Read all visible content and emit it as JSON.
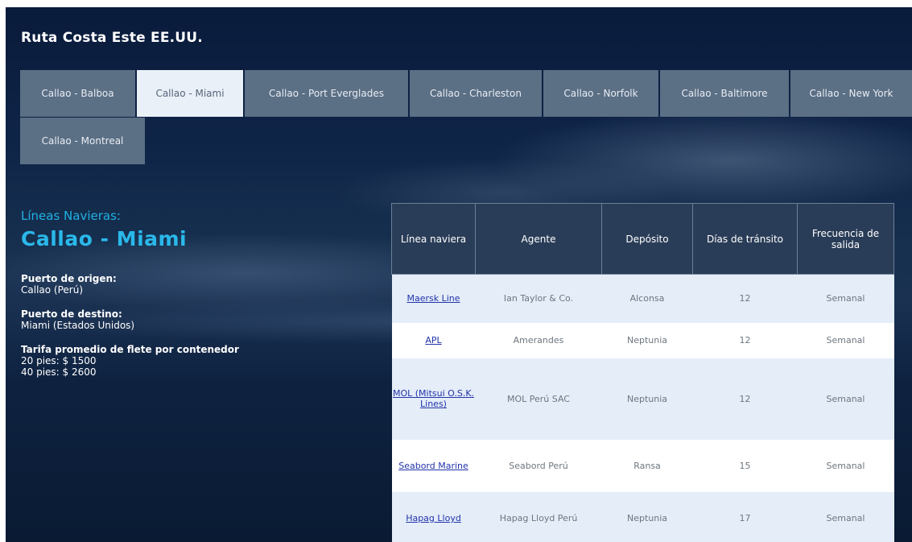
{
  "site": {
    "title": "Ruta Costa Este EE.UU."
  },
  "tabs": [
    {
      "label": "Callao - Balboa",
      "active": false
    },
    {
      "label": "Callao - Miami",
      "active": true
    },
    {
      "label": "Callao - Port Everglades",
      "active": false
    },
    {
      "label": "Callao - Charleston",
      "active": false
    },
    {
      "label": "Callao - Norfolk",
      "active": false
    },
    {
      "label": "Callao - Baltimore",
      "active": false
    },
    {
      "label": "Callao - New York",
      "active": false
    },
    {
      "label": "Callao - Montreal",
      "active": false
    }
  ],
  "route": {
    "lineas_label": "Líneas Navieras:",
    "title": "Callao - Miami",
    "origen_label": "Puerto de origen:",
    "origen_value": "Callao (Perú)",
    "destino_label": "Puerto de destino:",
    "destino_value": "Miami (Estados Unidos)",
    "tarifa_label": "Tarifa promedio de flete por contenedor",
    "tarifa_20": "20 pies: $ 1500",
    "tarifa_40": "40 pies: $ 2600"
  },
  "table": {
    "headers": {
      "linea": "Línea naviera",
      "agente": "Agente",
      "deposito": "Depósito",
      "dias": "Días de tránsito",
      "frecuencia": "Frecuencia de salida"
    },
    "rows": [
      {
        "linea": "Maersk Line",
        "agente": "Ian Taylor & Co.",
        "deposito": "Alconsa",
        "dias": "12",
        "frecuencia": "Semanal"
      },
      {
        "linea": "APL",
        "agente": "Amerandes",
        "deposito": "Neptunia",
        "dias": "12",
        "frecuencia": "Semanal"
      },
      {
        "linea": "MOL (Mitsui O.S.K. Lines)",
        "agente": "MOL Perú SAC",
        "deposito": "Neptunia",
        "dias": "12",
        "frecuencia": "Semanal"
      },
      {
        "linea": "Seabord Marine",
        "agente": "Seabord Perú",
        "deposito": "Ransa",
        "dias": "15",
        "frecuencia": "Semanal"
      },
      {
        "linea": "Hapag Lloyd",
        "agente": "Hapag Lloyd Perú",
        "deposito": "Neptunia",
        "dias": "17",
        "frecuencia": "Semanal"
      }
    ]
  }
}
